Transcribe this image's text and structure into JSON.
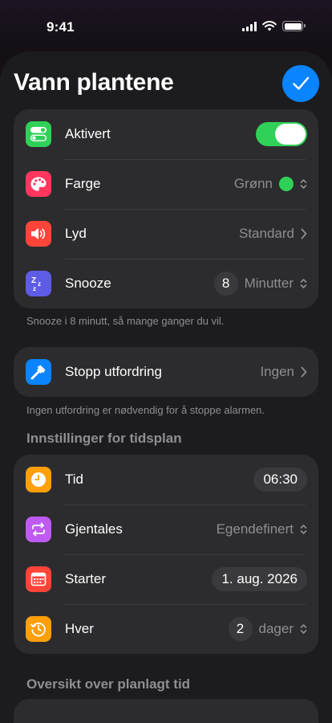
{
  "status_bar": {
    "time": "9:41"
  },
  "header": {
    "title": "Vann plantene"
  },
  "main_group": [
    {
      "label": "Aktivert",
      "value": ""
    },
    {
      "label": "Farge",
      "value": "Grønn"
    },
    {
      "label": "Lyd",
      "value": "Standard"
    },
    {
      "label": "Snooze",
      "count": "8",
      "unit": "Minutter"
    }
  ],
  "snooze_footer": "Snooze i 8 minutt, så mange ganger du vil.",
  "challenge": {
    "label": "Stopp utfordring",
    "value": "Ingen"
  },
  "challenge_footer": "Ingen utfordring er nødvendig for å stoppe alarmen.",
  "schedule": {
    "heading": "Innstillinger for tidsplan",
    "rows": [
      {
        "label": "Tid",
        "value": "06:30"
      },
      {
        "label": "Gjentales",
        "value": "Egendefinert"
      },
      {
        "label": "Starter",
        "value": "1. aug. 2026"
      },
      {
        "label": "Hver",
        "count": "2",
        "unit": "dager"
      }
    ]
  },
  "overview_heading": "Oversikt over planlagt tid",
  "colors": {
    "accent": "#0a84ff",
    "toggle_on": "#30d158",
    "selected_color": "#30d158",
    "icon_toggle": "#30d158",
    "icon_palette": "#ff375f",
    "icon_sound": "#ff453a",
    "icon_snooze": "#5e5ce6",
    "icon_hammer": "#0a84ff",
    "icon_clock": "#ff9f0a",
    "icon_repeat": "#bf5af2",
    "icon_calendar": "#ff453a",
    "icon_history": "#ff9f0a"
  },
  "toggles": {
    "enabled": true
  }
}
